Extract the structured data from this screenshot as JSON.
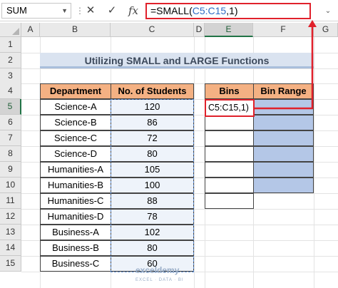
{
  "formula_bar": {
    "name_box": "SUM",
    "cancel_icon": "close-icon",
    "enter_icon": "check-icon",
    "function_icon": "fx-icon",
    "formula_prefix": "=SMALL(",
    "formula_ref": "C5:C15",
    "formula_suffix": ",1)"
  },
  "columns": [
    "A",
    "B",
    "C",
    "D",
    "E",
    "F",
    "G"
  ],
  "rows": [
    "1",
    "2",
    "3",
    "4",
    "5",
    "6",
    "7",
    "8",
    "9",
    "10",
    "11",
    "12",
    "13",
    "14",
    "15"
  ],
  "title": "Utilizing SMALL and LARGE Functions",
  "table": {
    "headers": [
      "Department",
      "No. of Students"
    ],
    "departments": [
      "Science-A",
      "Science-B",
      "Science-C",
      "Science-D",
      "Humanities-A",
      "Humanities-B",
      "Humanities-C",
      "Humanities-D",
      "Business-A",
      "Business-B",
      "Business-C"
    ],
    "students": [
      "120",
      "86",
      "72",
      "80",
      "105",
      "100",
      "88",
      "78",
      "102",
      "80",
      "60"
    ]
  },
  "bins_table": {
    "headers": [
      "Bins",
      "Bin Range"
    ],
    "active_cell_text": "C5:C15,1)"
  },
  "watermark": {
    "name": "exceldemy",
    "tagline": "EXCEL · DATA · BI"
  },
  "colors": {
    "accent_red": "#e0212b",
    "header_orange": "#f4b183",
    "bin_range_blue": "#b4c7e7",
    "title_bg": "#dae3f0"
  }
}
